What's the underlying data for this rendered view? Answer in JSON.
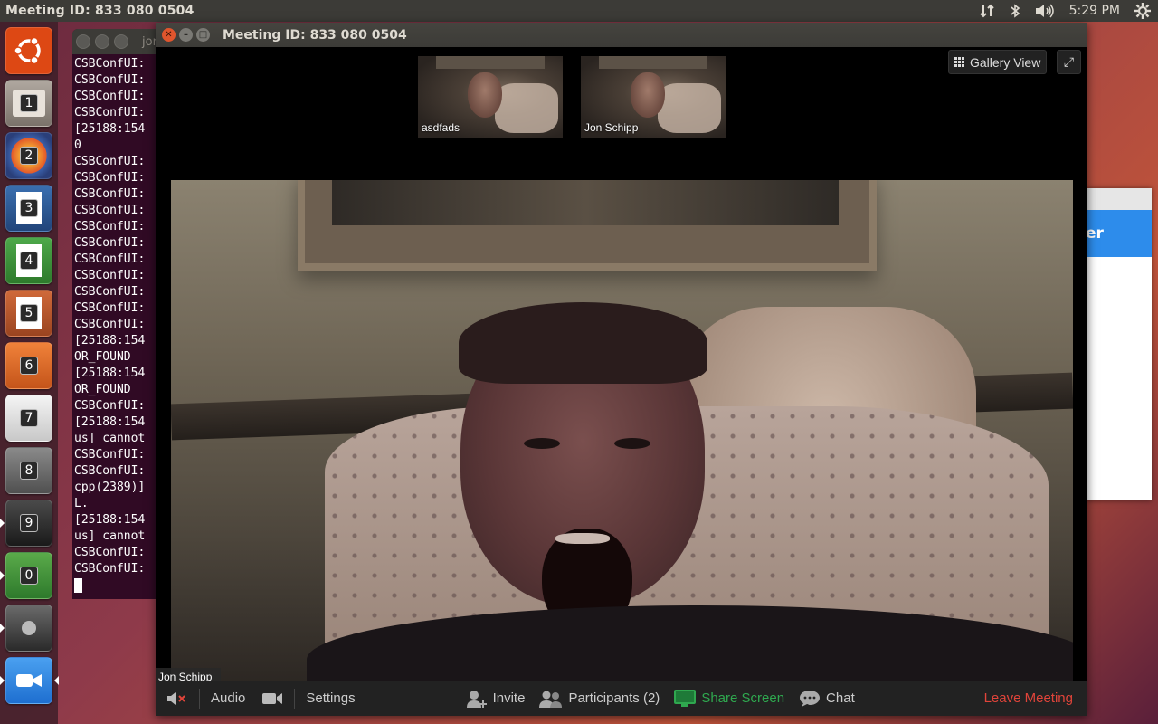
{
  "top_panel": {
    "title": "Meeting ID: 833 080 0504",
    "time": "5:29 PM",
    "indicators": [
      "network-icon",
      "bluetooth-icon",
      "volume-icon",
      "settings-gear-icon"
    ]
  },
  "launcher": {
    "items": [
      {
        "name": "ubuntu-logo-icon",
        "num": ""
      },
      {
        "name": "files-app-icon",
        "num": "1"
      },
      {
        "name": "firefox-icon",
        "num": "2"
      },
      {
        "name": "writer-icon",
        "num": "3"
      },
      {
        "name": "calc-icon",
        "num": "4"
      },
      {
        "name": "impress-icon",
        "num": "5"
      },
      {
        "name": "software-center-icon",
        "num": "6"
      },
      {
        "name": "amazon-icon",
        "num": "7"
      },
      {
        "name": "system-settings-icon",
        "num": "8"
      },
      {
        "name": "terminal-icon",
        "num": "9"
      },
      {
        "name": "updater-icon",
        "num": "0"
      },
      {
        "name": "disk-icon",
        "num": ""
      },
      {
        "name": "zoom-icon",
        "num": ""
      }
    ]
  },
  "terminal": {
    "title": "jor",
    "lines": [
      "CSBConfUI:",
      "CSBConfUI:",
      "CSBConfUI:",
      "CSBConfUI:",
      "[25188:154",
      "0",
      "CSBConfUI:",
      "CSBConfUI:",
      "CSBConfUI:",
      "CSBConfUI:",
      "CSBConfUI:",
      "CSBConfUI:",
      "CSBConfUI:",
      "CSBConfUI:",
      "CSBConfUI:",
      "CSBConfUI:",
      "CSBConfUI:",
      "[25188:154",
      "OR_FOUND",
      "[25188:154",
      "OR_FOUND",
      "CSBConfUI:",
      "[25188:154",
      "us] cannot",
      "CSBConfUI:",
      "CSBConfUI:",
      "cpp(2389)]",
      "L.",
      "[25188:154",
      "us] cannot",
      "CSBConfUI:",
      "CSBConfUI:"
    ]
  },
  "bg_dialog": {
    "fragment": "er"
  },
  "zoom": {
    "window_title": "Meeting ID: 833 080 0504",
    "thumbnails": [
      {
        "name": "asdfads"
      },
      {
        "name": "Jon Schipp"
      }
    ],
    "gallery_view_label": "Gallery View",
    "active_speaker": "Jon Schipp",
    "toolbar": {
      "audio": "Audio",
      "settings": "Settings",
      "invite": "Invite",
      "participants": "Participants (2)",
      "share_screen": "Share Screen",
      "chat": "Chat",
      "leave": "Leave Meeting"
    },
    "colors": {
      "share_screen": "#2fa84f",
      "leave": "#e0443a",
      "mute_x": "#e0443a"
    }
  }
}
